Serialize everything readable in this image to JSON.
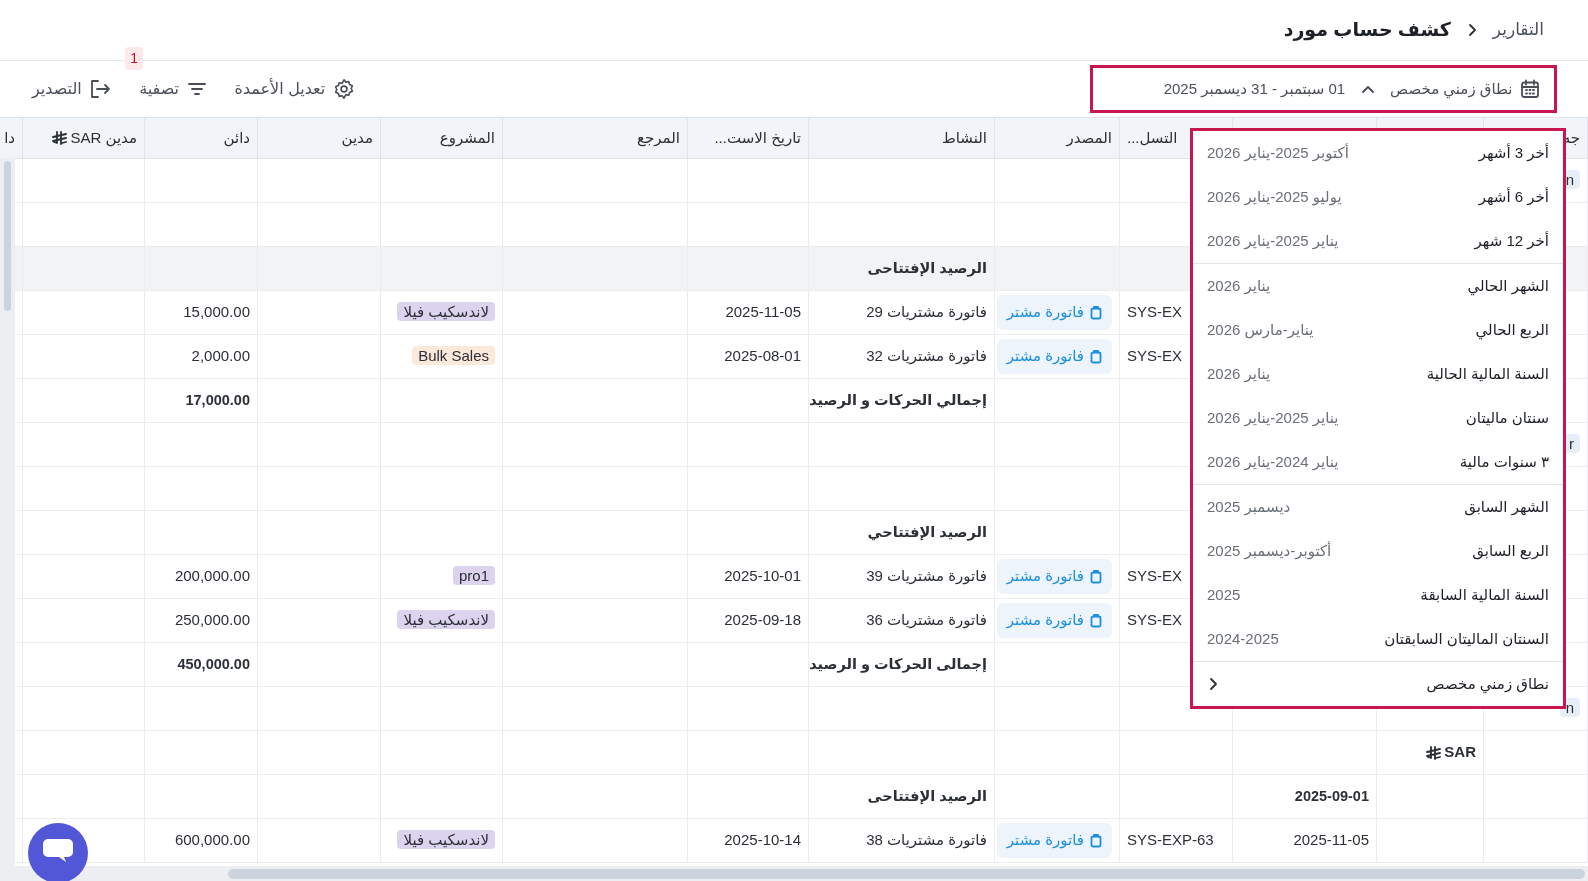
{
  "breadcrumb": {
    "parent": "التقارير",
    "current": "كشف حساب مورد"
  },
  "date_range": {
    "label": "نطاق زمني مخصص",
    "value": "01 سبتمبر - 31 ديسمبر 2025",
    "expanded": true
  },
  "toolbar": [
    {
      "kind": "columns",
      "label": "تعديل الأعمدة"
    },
    {
      "kind": "filter",
      "label": "تصفية",
      "badge": "1"
    },
    {
      "kind": "export",
      "label": "التصدير"
    }
  ],
  "range_menu": {
    "sections": [
      {
        "items": [
          {
            "label": "أخر 3 أشهر",
            "range": "أكتوبر 2025-يناير 2026"
          },
          {
            "label": "أخر 6 أشهر",
            "range": "يوليو 2025-يناير 2026"
          },
          {
            "label": "أخر 12 شهر",
            "range": "يناير 2025-يناير 2026"
          }
        ]
      },
      {
        "items": [
          {
            "label": "الشهر الحالي",
            "range": "يناير 2026"
          },
          {
            "label": "الربع الحالي",
            "range": "يناير-مارس 2026"
          },
          {
            "label": "السنة المالية الحالية",
            "range": "يناير 2026"
          },
          {
            "label": "سنتان ماليتان",
            "range": "يناير 2025-يناير 2026"
          },
          {
            "label": "٣ سنوات مالية",
            "range": "يناير 2024-يناير 2026"
          }
        ]
      },
      {
        "items": [
          {
            "label": "الشهر السابق",
            "range": "ديسمبر 2025"
          },
          {
            "label": "الربع السابق",
            "range": "أكتوبر-ديسمبر 2025"
          },
          {
            "label": "السنة المالية السابقة",
            "range": "2025"
          },
          {
            "label": "السنتان الماليتان السابقتان",
            "range": "2024-2025"
          }
        ]
      },
      {
        "items": [
          {
            "label": "نطاق زمني مخصص",
            "submenu": true
          }
        ]
      }
    ]
  },
  "table": {
    "columns": [
      {
        "label": "جه"
      },
      null,
      null,
      {
        "label": "التسل..."
      },
      {
        "label": "المصدر"
      },
      {
        "label": "النشاط"
      },
      {
        "label": "تاريخ الاست..."
      },
      {
        "label": "المرجع"
      },
      {
        "label": "المشروع"
      },
      {
        "label": "مدين"
      },
      {
        "label": "دائن"
      },
      {
        "label": "مدين SAR",
        "currency_icon": true
      },
      {
        "label": "دا"
      }
    ],
    "rows": [
      {
        "highlighted": false,
        "cells": [
          {
            "kind": "tag",
            "text": "n",
            "color": "#e6eef9"
          },
          null,
          null,
          null,
          null,
          null,
          null,
          null,
          null,
          null,
          null,
          null,
          null
        ]
      },
      {
        "highlighted": false
      },
      {
        "highlighted": true,
        "cells": [
          null,
          null,
          null,
          null,
          null,
          {
            "kind": "bold",
            "text": "الرصيد الإفتتاحى"
          },
          null,
          null,
          null,
          null,
          null,
          null,
          null
        ]
      },
      {
        "highlighted": false,
        "cells": [
          null,
          null,
          null,
          {
            "kind": "text",
            "text": "SYS-EX"
          },
          {
            "kind": "link",
            "text": "فاتورة مشتر"
          },
          {
            "kind": "text",
            "text": "فاتورة مشتريات 29"
          },
          {
            "kind": "text",
            "text": "2025-11-05"
          },
          null,
          {
            "kind": "tag",
            "text": "لاندسكيب فيلا",
            "color": "#dcd4ee"
          },
          null,
          {
            "kind": "text",
            "text": "15,000.00"
          },
          null,
          null
        ]
      },
      {
        "highlighted": false,
        "cells": [
          null,
          null,
          null,
          {
            "kind": "text",
            "text": "SYS-EX"
          },
          {
            "kind": "link",
            "text": "فاتورة مشتر"
          },
          {
            "kind": "text",
            "text": "فاتورة مشتريات 32"
          },
          {
            "kind": "text",
            "text": "2025-08-01"
          },
          null,
          {
            "kind": "tag",
            "text": "Bulk Sales",
            "color": "#fbeadc"
          },
          null,
          {
            "kind": "text",
            "text": "2,000.00"
          },
          null,
          null
        ]
      },
      {
        "highlighted": false,
        "cells": [
          null,
          null,
          null,
          null,
          null,
          {
            "kind": "bold",
            "text": "إجمالي الحركات و الرصيد"
          },
          null,
          null,
          null,
          null,
          {
            "kind": "bold",
            "text": "17,000.00"
          },
          null,
          null
        ]
      },
      {
        "highlighted": false,
        "cells": [
          {
            "kind": "tag",
            "text": "r",
            "color": "#e6eef9"
          },
          null,
          null,
          null,
          null,
          null,
          null,
          null,
          null,
          null,
          null,
          null,
          null
        ]
      },
      {
        "highlighted": false
      },
      {
        "highlighted": false,
        "cells": [
          null,
          null,
          null,
          null,
          null,
          {
            "kind": "bold",
            "text": "الرصيد الإفتتاحي"
          },
          null,
          null,
          null,
          null,
          null,
          null,
          null
        ]
      },
      {
        "highlighted": false,
        "cells": [
          null,
          null,
          null,
          {
            "kind": "text",
            "text": "SYS-EX"
          },
          {
            "kind": "link",
            "text": "فاتورة مشتر"
          },
          {
            "kind": "text",
            "text": "فاتورة مشتريات 39"
          },
          {
            "kind": "text",
            "text": "2025-10-01"
          },
          null,
          {
            "kind": "tag",
            "text": "pro1",
            "color": "#dcd4ee"
          },
          null,
          {
            "kind": "text",
            "text": "200,000.00"
          },
          null,
          null
        ]
      },
      {
        "highlighted": false,
        "cells": [
          null,
          null,
          null,
          {
            "kind": "text",
            "text": "SYS-EX"
          },
          {
            "kind": "link",
            "text": "فاتورة مشتر"
          },
          {
            "kind": "text",
            "text": "فاتورة مشتريات 36"
          },
          {
            "kind": "text",
            "text": "2025-09-18"
          },
          null,
          {
            "kind": "tag",
            "text": "لاندسكيب فيلا",
            "color": "#dcd4ee"
          },
          null,
          {
            "kind": "text",
            "text": "250,000.00"
          },
          null,
          null
        ]
      },
      {
        "highlighted": false,
        "cells": [
          null,
          null,
          null,
          null,
          null,
          {
            "kind": "bold",
            "text": "إجمالى الحركات و الرصيد"
          },
          null,
          null,
          null,
          null,
          {
            "kind": "bold",
            "text": "450,000.00"
          },
          null,
          null
        ]
      },
      {
        "highlighted": false,
        "cells": [
          {
            "kind": "tag",
            "text": "n",
            "color": "#e6eef9"
          },
          null,
          null,
          null,
          null,
          null,
          null,
          null,
          null,
          null,
          null,
          null,
          null
        ]
      },
      {
        "highlighted": false,
        "cells": [
          null,
          {
            "kind": "currency",
            "text": "SAR"
          },
          null,
          null,
          null,
          null,
          null,
          null,
          null,
          null,
          null,
          null,
          null
        ]
      },
      {
        "highlighted": false,
        "cells": [
          null,
          null,
          {
            "kind": "bold",
            "text": "2025-09-01"
          },
          null,
          null,
          {
            "kind": "bold",
            "text": "الرصيد الإفتتاحى"
          },
          null,
          null,
          null,
          null,
          null,
          null,
          null
        ]
      },
      {
        "highlighted": false,
        "cells": [
          null,
          null,
          {
            "kind": "text",
            "text": "2025-11-05"
          },
          {
            "kind": "text",
            "text": "SYS-EXP-63"
          },
          {
            "kind": "link",
            "text": "فاتورة مشتر"
          },
          {
            "kind": "text",
            "text": "فاتورة مشتريات 38"
          },
          {
            "kind": "text",
            "text": "2025-10-14"
          },
          null,
          {
            "kind": "tag",
            "text": "لاندسكيب فيلا",
            "color": "#dcd4ee"
          },
          null,
          {
            "kind": "text",
            "text": "600,000.00"
          },
          null,
          null
        ]
      }
    ]
  }
}
